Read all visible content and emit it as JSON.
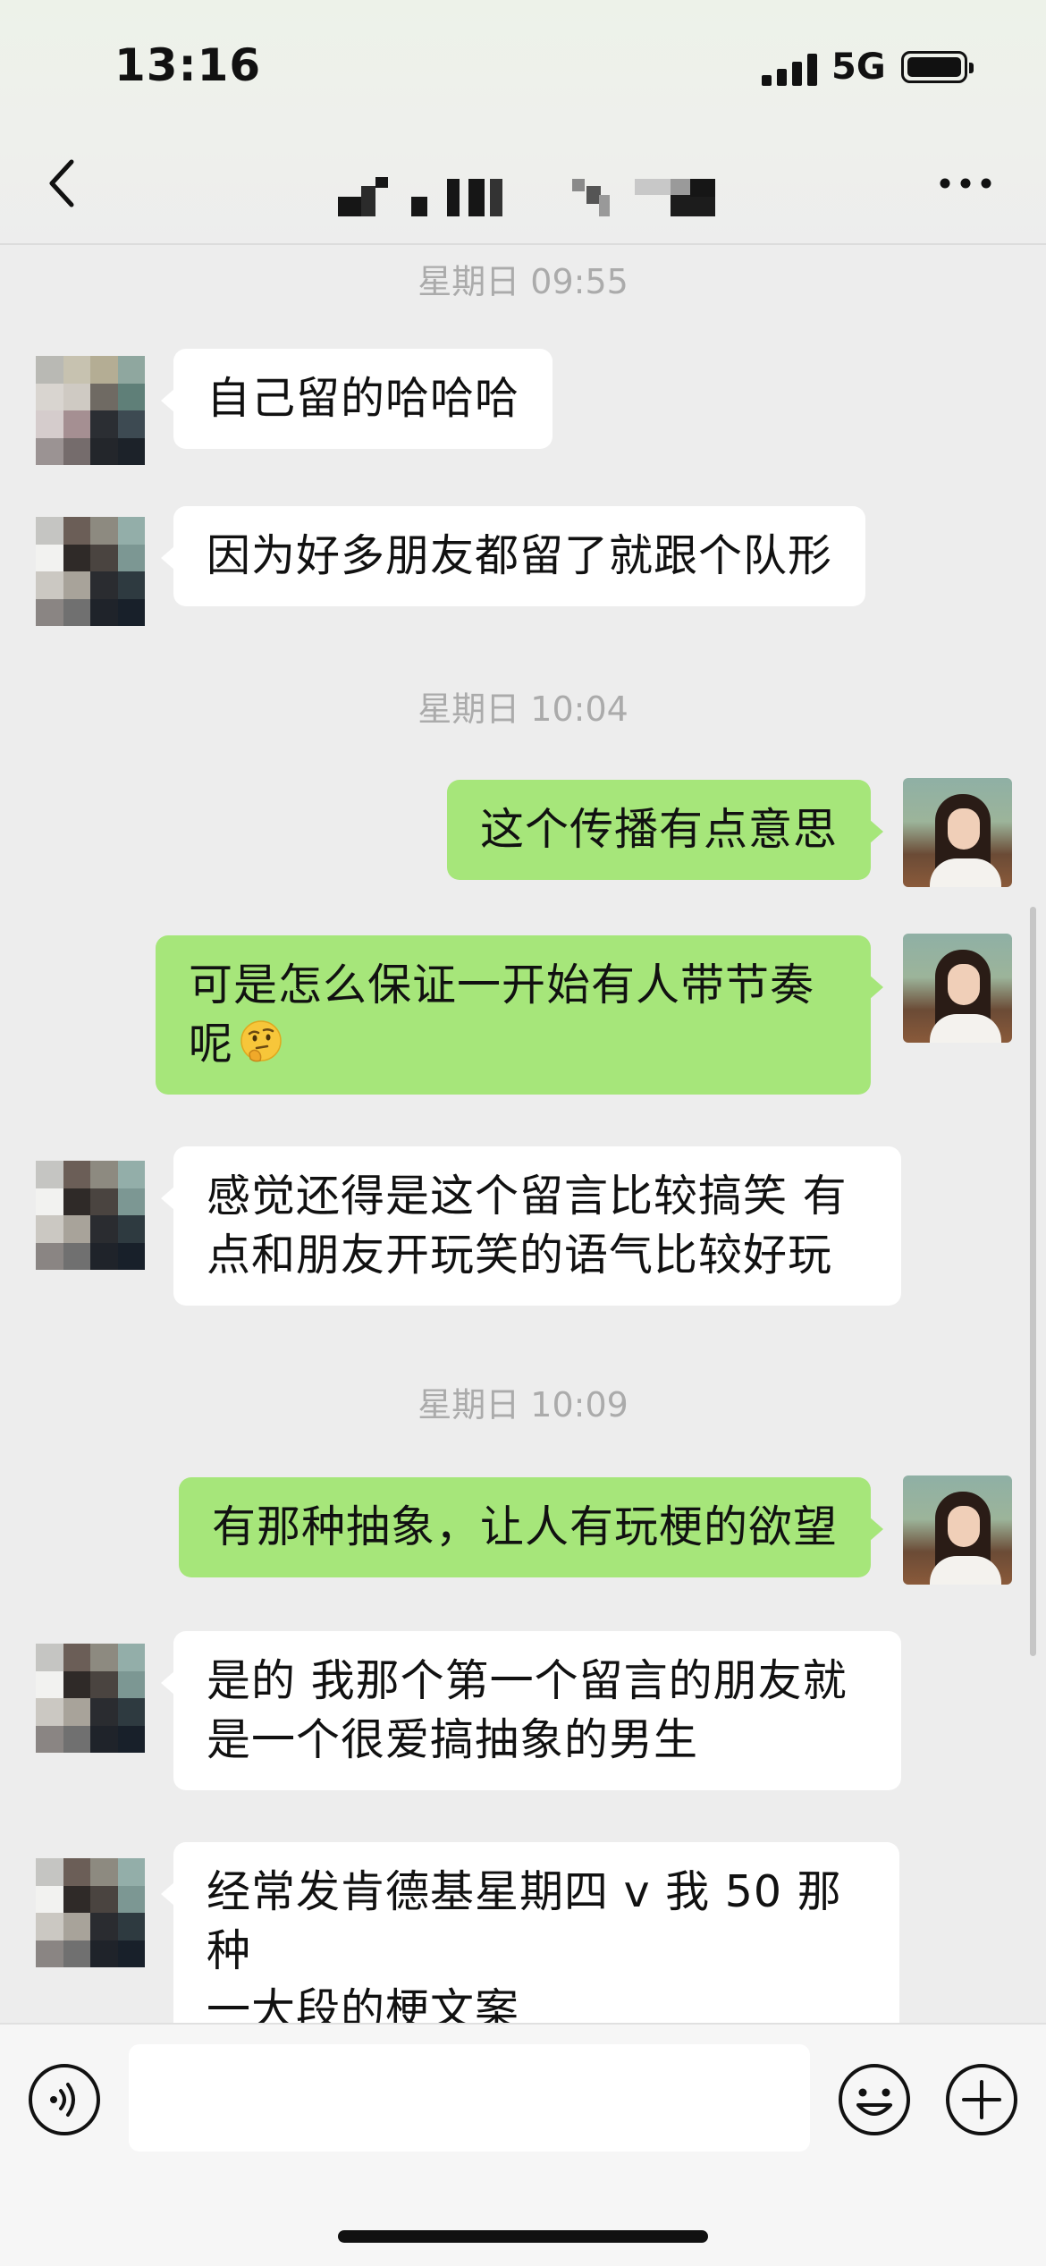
{
  "status_bar": {
    "time": "13:16",
    "network": "5G"
  },
  "nav": {
    "title_pixelated": true
  },
  "messages": [
    {
      "kind": "timestamp",
      "text": "星期日 09:55"
    },
    {
      "kind": "incoming",
      "text": "自己留的哈哈哈"
    },
    {
      "kind": "incoming",
      "text": "因为好多朋友都留了就跟个队形"
    },
    {
      "kind": "timestamp",
      "text": "星期日 10:04"
    },
    {
      "kind": "outgoing",
      "text": "这个传播有点意思"
    },
    {
      "kind": "outgoing",
      "line1": "可是怎么保证一开始有人带节奏",
      "line2": "呢",
      "emoji": "thinking-face"
    },
    {
      "kind": "incoming",
      "line1": "感觉还得是这个留言比较搞笑 有",
      "line2": "点和朋友开玩笑的语气比较好玩"
    },
    {
      "kind": "timestamp",
      "text": "星期日 10:09"
    },
    {
      "kind": "outgoing",
      "text": "有那种抽象，让人有玩梗的欲望"
    },
    {
      "kind": "incoming",
      "line1": "是的 我那个第一个留言的朋友就",
      "line2": "是一个很爱搞抽象的男生"
    },
    {
      "kind": "incoming",
      "line1": "经常发肯德基星期四 v 我 50 那种",
      "line2": "一大段的梗文案"
    }
  ],
  "input_bar": {
    "placeholder": "",
    "icons": [
      "voice-icon",
      "emoji-icon",
      "plus-icon"
    ]
  },
  "colors": {
    "background": "#ededed",
    "outgoing_bubble": "#a6e67a",
    "incoming_bubble": "#ffffff",
    "timestamp_text": "#ababab"
  }
}
